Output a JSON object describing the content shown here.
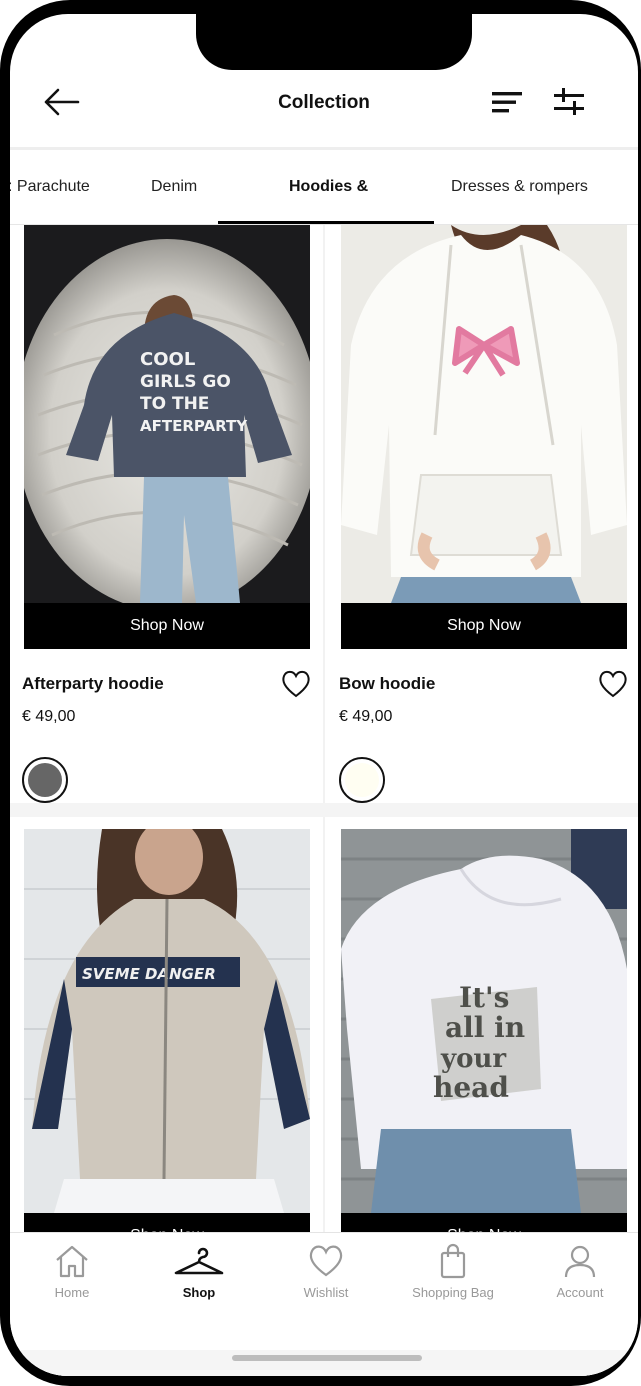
{
  "header": {
    "title": "Collection",
    "back_icon": "arrow-left-icon",
    "sort_icon": "sort-lines-icon",
    "filter_icon": "sliders-icon"
  },
  "tabs": [
    {
      "label": "Parachute",
      "active": false
    },
    {
      "label": "Denim",
      "active": false
    },
    {
      "label": "Hoodies &",
      "active": true
    },
    {
      "label": "Dresses & rompers",
      "active": false
    }
  ],
  "products": [
    {
      "name": "Afterparty hoodie",
      "price": "€ 49,00",
      "cta": "Shop Now",
      "swatch_color": "#666666",
      "print_text": "COOL GIRLS GO TO THE AFTERPARTY"
    },
    {
      "name": "Bow hoodie",
      "price": "€ 49,00",
      "cta": "Shop Now",
      "swatch_color": "#fffef2"
    },
    {
      "name": "",
      "price": "",
      "cta": "Shop Now",
      "print_text": "SVEME DANGER"
    },
    {
      "name": "",
      "price": "",
      "cta": "Shop Now",
      "print_text": "It's all in your head"
    }
  ],
  "nav": {
    "items": [
      {
        "label": "Home",
        "icon": "home-icon",
        "active": false
      },
      {
        "label": "Shop",
        "icon": "hanger-icon",
        "active": true
      },
      {
        "label": "Wishlist",
        "icon": "heart-icon",
        "active": false
      },
      {
        "label": "Shopping Bag",
        "icon": "shopping-bag-icon",
        "active": false
      },
      {
        "label": "Account",
        "icon": "user-icon",
        "active": false
      }
    ]
  },
  "colors": {
    "accent": "#000000",
    "muted": "#999999"
  }
}
